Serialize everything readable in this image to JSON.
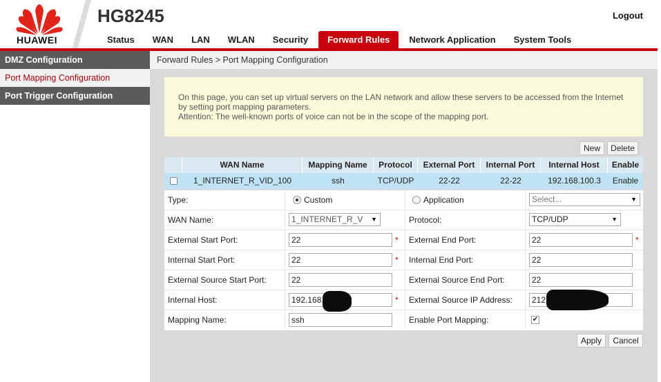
{
  "brand": {
    "logo_text": "HUAWEI",
    "model": "HG8245",
    "accent": "#c7000b"
  },
  "header": {
    "logout": "Logout",
    "nav": [
      "Status",
      "WAN",
      "LAN",
      "WLAN",
      "Security",
      "Forward Rules",
      "Network Application",
      "System Tools"
    ],
    "active_nav": "Forward Rules"
  },
  "sidebar": {
    "items": [
      {
        "label": "DMZ Configuration"
      },
      {
        "label": "Port Mapping Configuration"
      },
      {
        "label": "Port Trigger Configuration"
      }
    ]
  },
  "breadcrumb": "Forward Rules > Port Mapping Configuration",
  "info": {
    "line1": "On this page, you can set up virtual servers on the LAN network and allow these servers to be accessed from the Internet",
    "line2": "by setting port mapping parameters.",
    "line3": "Attention: The well-known ports of voice can not be in the scope of the mapping port."
  },
  "actions": {
    "new": "New",
    "delete": "Delete",
    "apply": "Apply",
    "cancel": "Cancel"
  },
  "table": {
    "headers": [
      "WAN Name",
      "Mapping Name",
      "Protocol",
      "External Port",
      "Internal Port",
      "Internal Host",
      "Enable"
    ],
    "rows": [
      [
        "1_INTERNET_R_VID_100",
        "ssh",
        "TCP/UDP",
        "22-22",
        "22-22",
        "192.168.100.3",
        "Enable"
      ]
    ]
  },
  "form": {
    "type_label": "Type:",
    "type_custom": "Custom",
    "type_application": "Application",
    "application_select": "Select...",
    "wan_name_label": "WAN Name:",
    "wan_name_value": "1_INTERNET_R_V",
    "protocol_label": "Protocol:",
    "protocol_value": "TCP/UDP",
    "ext_start_label": "External Start Port:",
    "ext_start_value": "22",
    "ext_end_label": "External End Port:",
    "ext_end_value": "22",
    "int_start_label": "Internal Start Port:",
    "int_start_value": "22",
    "int_end_label": "Internal End Port:",
    "int_end_value": "22",
    "src_start_label": "External Source Start Port:",
    "src_start_value": "22",
    "src_end_label": "External Source End Port:",
    "src_end_value": "22",
    "int_host_label": "Internal Host:",
    "int_host_value": "192.168.",
    "src_ip_label": "External Source IP Address:",
    "src_ip_value": "212.",
    "mapping_name_label": "Mapping Name:",
    "mapping_name_value": "ssh",
    "enable_label": "Enable Port Mapping:",
    "required_mark": "*",
    "checked_mark": "✔",
    "arrow": "▼"
  }
}
